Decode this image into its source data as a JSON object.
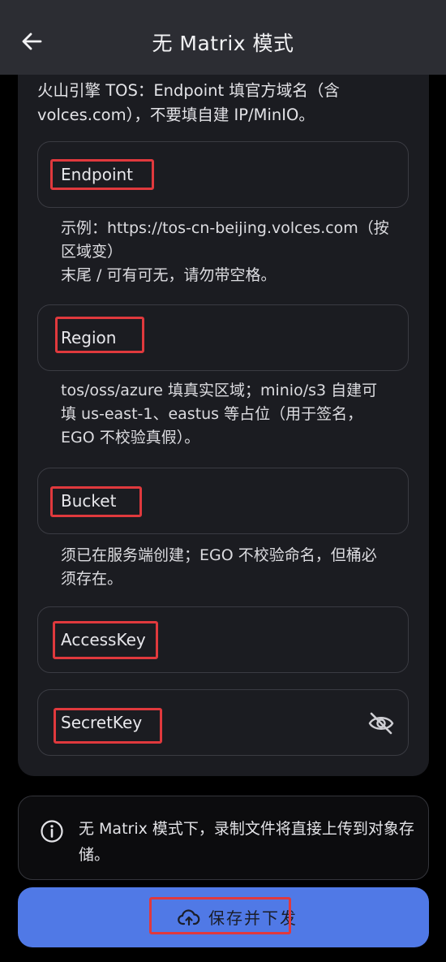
{
  "header": {
    "title": "无 Matrix 模式",
    "back_icon": "arrow-left-icon"
  },
  "intro": "火山引擎 TOS：Endpoint 填官方域名（含 volces.com），不要填自建 IP/MinIO。",
  "fields": {
    "endpoint": {
      "label": "Endpoint",
      "helper_line1": "示例：https://tos-cn-beijing.volces.com（按区域变）",
      "helper_line2": "末尾 / 可有可无，请勿带空格。"
    },
    "region": {
      "label": "Region",
      "helper": "tos/oss/azure 填真实区域；minio/s3 自建可填 us-east-1、eastus 等占位（用于签名，EGO 不校验真假）。"
    },
    "bucket": {
      "label": "Bucket",
      "helper": "须已在服务端创建；EGO 不校验命名，但桶必须存在。"
    },
    "access_key": {
      "label": "AccessKey"
    },
    "secret_key": {
      "label": "SecretKey",
      "toggle_icon": "eye-off-icon"
    }
  },
  "notice": {
    "icon": "info-icon",
    "text": "无 Matrix 模式下，录制文件将直接上传到对象存储。"
  },
  "save_button": {
    "icon": "cloud-upload-icon",
    "label": "保存并下发"
  },
  "colors": {
    "appbar": "#2c2d33",
    "card": "#1b1c21",
    "accent": "#5079e6",
    "highlight": "#e0393d"
  }
}
